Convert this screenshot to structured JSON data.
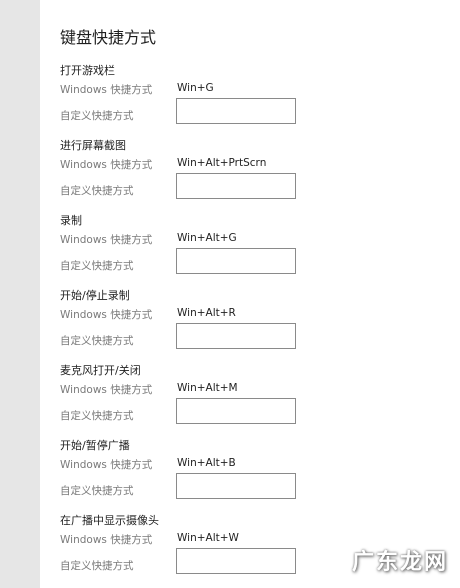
{
  "page": {
    "title": "键盘快捷方式"
  },
  "labels": {
    "windows_shortcut": "Windows 快捷方式",
    "custom_shortcut": "自定义快捷方式"
  },
  "sections": [
    {
      "title": "打开游戏栏",
      "shortcut": "Win+G",
      "custom_value": ""
    },
    {
      "title": "进行屏幕截图",
      "shortcut": "Win+Alt+PrtScrn",
      "custom_value": ""
    },
    {
      "title": "录制",
      "shortcut": "Win+Alt+G",
      "custom_value": ""
    },
    {
      "title": "开始/停止录制",
      "shortcut": "Win+Alt+R",
      "custom_value": ""
    },
    {
      "title": "麦克风打开/关闭",
      "shortcut": "Win+Alt+M",
      "custom_value": ""
    },
    {
      "title": "开始/暂停广播",
      "shortcut": "Win+Alt+B",
      "custom_value": ""
    },
    {
      "title": "在广播中显示摄像头",
      "shortcut": "Win+Alt+W",
      "custom_value": ""
    }
  ],
  "watermark": "广东龙网"
}
